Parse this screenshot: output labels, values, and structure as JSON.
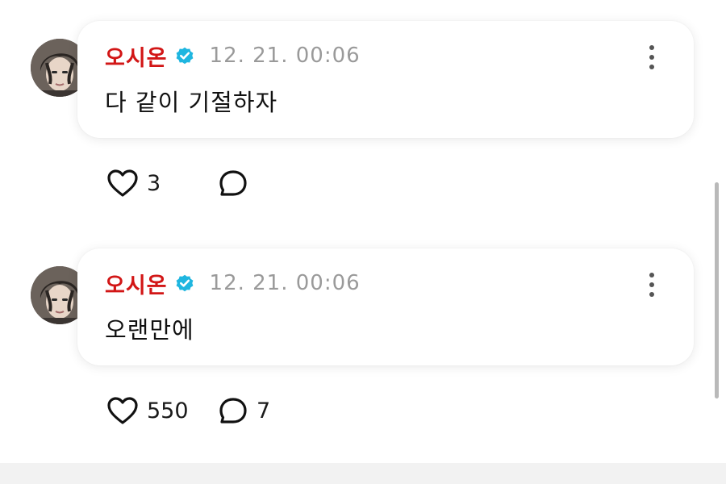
{
  "posts": [
    {
      "author": "오시온",
      "verified": true,
      "timestamp": "12. 21. 00:06",
      "text": "다 같이 기절하자",
      "likes": "3",
      "comments": ""
    },
    {
      "author": "오시온",
      "verified": true,
      "timestamp": "12. 21. 00:06",
      "text": "오랜만에",
      "likes": "550",
      "comments": "7"
    }
  ],
  "colors": {
    "author_name": "#d21616",
    "verified_badge": "#1fb6e0",
    "timestamp": "#9a9a9a"
  },
  "icons": {
    "verified": "verified-badge-icon",
    "more": "more-vertical-icon",
    "like": "heart-outline-icon",
    "comment": "comment-bubble-icon"
  }
}
